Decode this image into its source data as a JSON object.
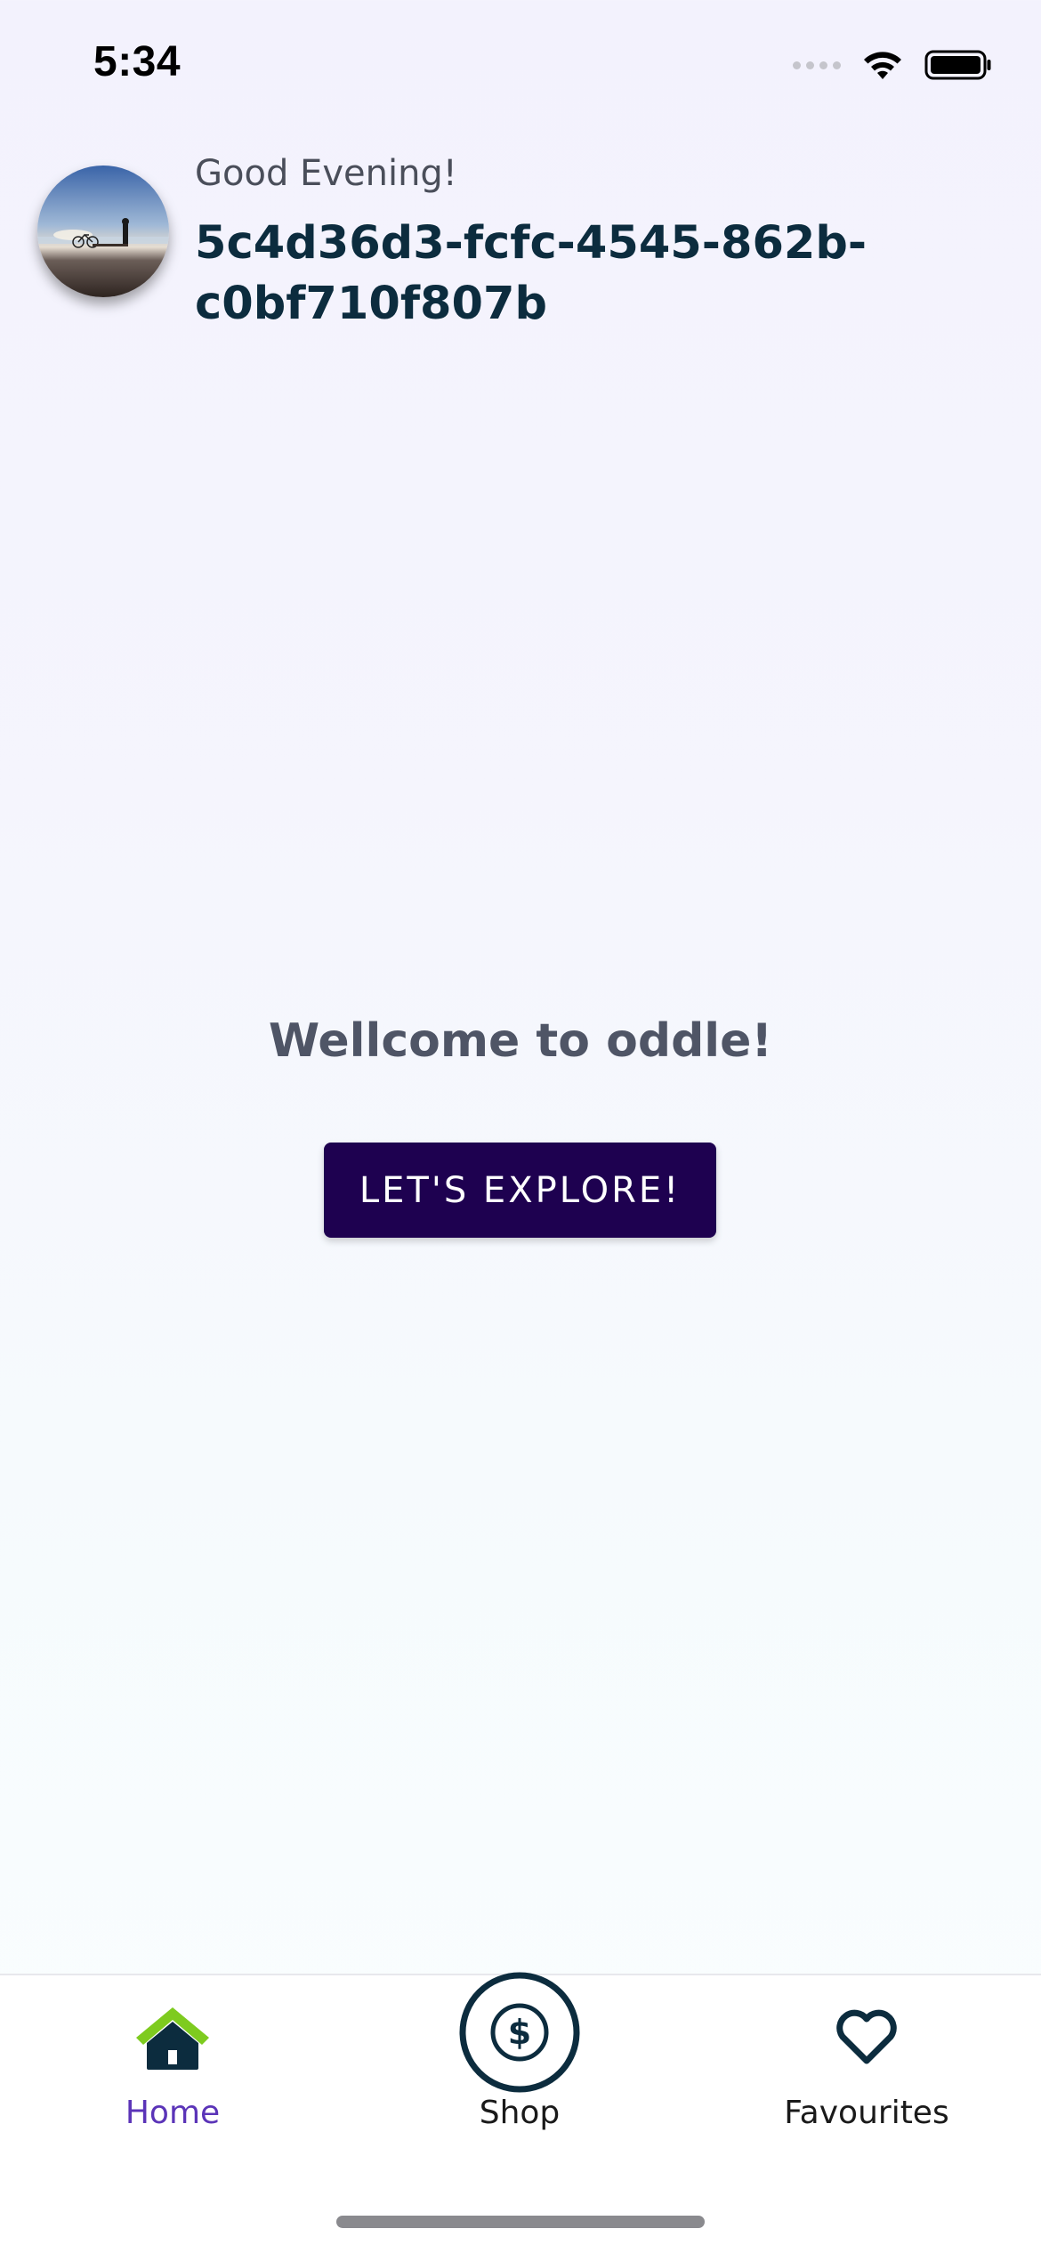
{
  "status_bar": {
    "time": "5:34"
  },
  "header": {
    "greeting": "Good Evening!",
    "user_name": "5c4d36d3-fcfc-4545-862b-c0bf710f807b"
  },
  "main": {
    "welcome_text": "Wellcome to oddle!",
    "explore_button_label": "LET'S EXPLORE!"
  },
  "bottom_nav": {
    "items": [
      {
        "label": "Home",
        "icon": "home-icon",
        "active": true
      },
      {
        "label": "Shop",
        "icon": "dollar-icon",
        "active": false
      },
      {
        "label": "Favourites",
        "icon": "heart-icon",
        "active": false
      }
    ]
  },
  "colors": {
    "primary_button": "#1e0150",
    "active_tab": "#5b34b8",
    "home_roof": "#7ecb1f",
    "icon_dark": "#0c2c3e",
    "title_text": "#0c2c3e"
  }
}
